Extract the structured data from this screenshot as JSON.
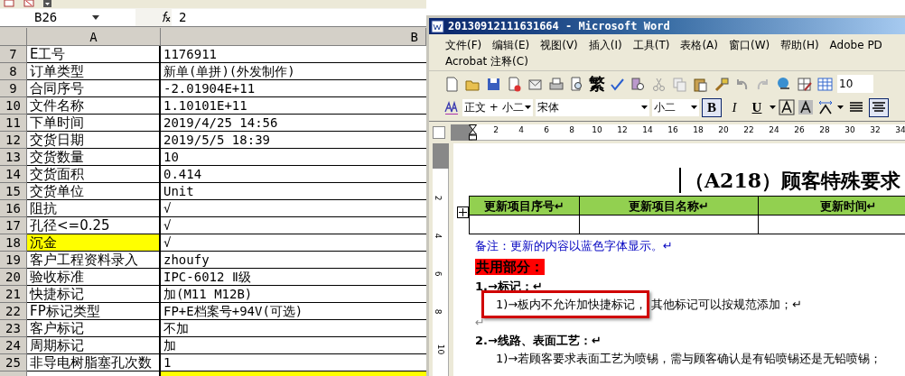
{
  "excel": {
    "name_box": "B26",
    "formula": "2",
    "columns": [
      "A",
      "B"
    ],
    "rows": [
      {
        "number": "7",
        "label": "E工号",
        "value": "1176911",
        "label_highlighted": false
      },
      {
        "number": "8",
        "label": "订单类型",
        "value": "新单(单拼)(外发制作)",
        "label_highlighted": false
      },
      {
        "number": "9",
        "label": "合同序号",
        "value": "-2.01904E+11",
        "label_highlighted": false
      },
      {
        "number": "10",
        "label": "文件名称",
        "value": "1.10101E+11",
        "label_highlighted": false
      },
      {
        "number": "11",
        "label": "下单时间",
        "value": "2019/4/25 14:56",
        "label_highlighted": false
      },
      {
        "number": "12",
        "label": "交货日期",
        "value": "2019/5/5 18:39",
        "label_highlighted": false
      },
      {
        "number": "13",
        "label": "交货数量",
        "value": "10",
        "label_highlighted": false
      },
      {
        "number": "14",
        "label": "交货面积",
        "value": "0.414",
        "label_highlighted": false
      },
      {
        "number": "15",
        "label": "交货单位",
        "value": "Unit",
        "label_highlighted": false
      },
      {
        "number": "16",
        "label": "阻抗",
        "value": "√",
        "label_highlighted": false
      },
      {
        "number": "17",
        "label": "孔径<=0.25",
        "value": "√",
        "label_highlighted": false
      },
      {
        "number": "18",
        "label": "沉金",
        "value": "√",
        "label_highlighted": true
      },
      {
        "number": "19",
        "label": "客户工程资料录入",
        "value": "zhoufy",
        "label_highlighted": false
      },
      {
        "number": "20",
        "label": "验收标准",
        "value": "IPC-6012 Ⅱ级",
        "label_highlighted": false
      },
      {
        "number": "21",
        "label": "快捷标记",
        "value": "加(M11 M12B)",
        "label_highlighted": false
      },
      {
        "number": "22",
        "label": "FP标记类型",
        "value": "FP+E档案号+94V(可选)",
        "label_highlighted": false
      },
      {
        "number": "23",
        "label": "客户标记",
        "value": "不加",
        "label_highlighted": false
      },
      {
        "number": "24",
        "label": "周期标记",
        "value": "加",
        "label_highlighted": false
      },
      {
        "number": "25",
        "label": "非导电树脂塞孔次数",
        "value": "1",
        "label_highlighted": false
      }
    ],
    "cut_row": {
      "label_highlighted": false,
      "value_highlighted": true
    }
  },
  "word": {
    "title": "20130912111631664 - Microsoft Word",
    "menu_lines": [
      [
        "文件(F)",
        "编辑(E)",
        "视图(V)",
        "插入(I)",
        "工具(T)",
        "表格(A)",
        "窗口(W)",
        "帮助(H)",
        "Adobe PD"
      ],
      [
        "Acrobat 注释(C)"
      ]
    ],
    "traditional_button": "繁",
    "zoom_box": "10",
    "style_box": "正文 + 小二",
    "font_box": "宋体",
    "size_box": "小二",
    "format_buttons": [
      {
        "label": "B",
        "pressed": true
      },
      {
        "label": "I",
        "pressed": false
      },
      {
        "label": "U",
        "pressed": false
      }
    ],
    "align_buttons": [
      {
        "selected": false
      },
      {
        "selected": true
      }
    ],
    "ruler_numbers": [
      "2",
      "4",
      "6",
      "8",
      "10",
      "12",
      "14",
      "16",
      "18",
      "20",
      "22",
      "24",
      "26",
      "28",
      "30",
      "32",
      "34"
    ],
    "vertical_ruler_numbers": [
      "2",
      "4",
      "6",
      "8",
      "10"
    ],
    "document": {
      "title": "（A218）顾客特殊要求",
      "table_headers": [
        "更新项目序号↵",
        "更新项目名称↵",
        "更新时间↵"
      ],
      "note": "备注：更新的内容以蓝色字体显示。↵",
      "section": "共用部分：",
      "paragraphs": [
        {
          "kind": "heading",
          "text": "1.→标记：↵"
        },
        {
          "kind": "item",
          "boxed_text": "1)→板内不允许加快捷标记，",
          "text": "其他标记可以按规范添加；↵"
        },
        {
          "kind": "blank",
          "text": "↵"
        },
        {
          "kind": "heading",
          "text": "2.→线路、表面工艺：↵"
        },
        {
          "kind": "item",
          "text": "1)→若顾客要求表面工艺为喷锡，需与顾客确认是有铅喷锡还是无铅喷锡；"
        }
      ]
    }
  }
}
